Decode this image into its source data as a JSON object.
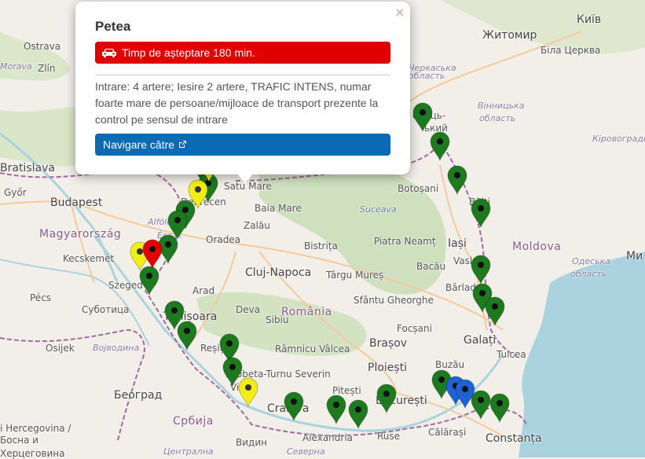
{
  "map": {
    "places": [
      {
        "name": "Ostrava",
        "cls": "place"
      },
      {
        "name": "Morava",
        "cls": "place region"
      },
      {
        "name": "Zlín",
        "cls": "place"
      },
      {
        "name": "Bratislava",
        "cls": "place big"
      },
      {
        "name": "Győr",
        "cls": "place"
      },
      {
        "name": "Budapest",
        "cls": "place big"
      },
      {
        "name": "Magyarország",
        "cls": "place country"
      },
      {
        "name": "Kecskemét",
        "cls": "place"
      },
      {
        "name": "Pécs",
        "cls": "place"
      },
      {
        "name": "Szeged",
        "cls": "place"
      },
      {
        "name": "Суботица",
        "cls": "place"
      },
      {
        "name": "Osijek",
        "cls": "place"
      },
      {
        "name": "Војводина",
        "cls": "place region"
      },
      {
        "name": "Београд",
        "cls": "place big"
      },
      {
        "name": "Србија",
        "cls": "place country"
      },
      {
        "name": "i Hercegovina /",
        "cls": "place"
      },
      {
        "name": "Босна и",
        "cls": "place"
      },
      {
        "name": "Херцеговина",
        "cls": "place"
      },
      {
        "name": "Alföld és",
        "cls": "place region"
      },
      {
        "name": "Észak",
        "cls": "place region"
      },
      {
        "name": "Debrecen",
        "cls": "place"
      },
      {
        "name": "Oradea",
        "cls": "place"
      },
      {
        "name": "Arad",
        "cls": "place"
      },
      {
        "name": "Timișoara",
        "cls": "place big"
      },
      {
        "name": "Reșița",
        "cls": "place"
      },
      {
        "name": "Drobeta-Turnu Severin",
        "cls": "place"
      },
      {
        "name": "Vidin",
        "cls": "place"
      },
      {
        "name": "Видин",
        "cls": "place"
      },
      {
        "name": "Craiova",
        "cls": "place big"
      },
      {
        "name": "Alexandria",
        "cls": "place"
      },
      {
        "name": "Ruse",
        "cls": "place"
      },
      {
        "name": "Pitești",
        "cls": "place"
      },
      {
        "name": "Râmnicu Vâlcea",
        "cls": "place"
      },
      {
        "name": "Deva",
        "cls": "place"
      },
      {
        "name": "România",
        "cls": "place country"
      },
      {
        "name": "Cluj-Napoca",
        "cls": "place big"
      },
      {
        "name": "Zalău",
        "cls": "place"
      },
      {
        "name": "Baia Mare",
        "cls": "place"
      },
      {
        "name": "Satu Mare",
        "cls": "place"
      },
      {
        "name": "Bistrița",
        "cls": "place"
      },
      {
        "name": "Târgu Mureș",
        "cls": "place"
      },
      {
        "name": "Sibiu",
        "cls": "place"
      },
      {
        "name": "Sfântu Gheorghe",
        "cls": "place"
      },
      {
        "name": "Brașov",
        "cls": "place big"
      },
      {
        "name": "Ploiești",
        "cls": "place big"
      },
      {
        "name": "București",
        "cls": "place big"
      },
      {
        "name": "Buzău",
        "cls": "place"
      },
      {
        "name": "Focșani",
        "cls": "place"
      },
      {
        "name": "Bacău",
        "cls": "place"
      },
      {
        "name": "Piatra Neamț",
        "cls": "place"
      },
      {
        "name": "Suceava",
        "cls": "place river"
      },
      {
        "name": "Botoșani",
        "cls": "place"
      },
      {
        "name": "Iași",
        "cls": "place big"
      },
      {
        "name": "Vaslui",
        "cls": "place"
      },
      {
        "name": "Moldova",
        "cls": "place country"
      },
      {
        "name": "Bălți",
        "cls": "place"
      },
      {
        "name": "Bârlad",
        "cls": "place"
      },
      {
        "name": "Galați",
        "cls": "place big"
      },
      {
        "name": "Tulcea",
        "cls": "place"
      },
      {
        "name": "Călărași",
        "cls": "place"
      },
      {
        "name": "Constanța",
        "cls": "place big"
      },
      {
        "name": "Житомир",
        "cls": "place big"
      },
      {
        "name": "Київ",
        "cls": "place big"
      },
      {
        "name": "Біла Церква",
        "cls": "place"
      },
      {
        "name": "Вінницька",
        "cls": "place region"
      },
      {
        "name": "область",
        "cls": "place region"
      },
      {
        "name": "Кіровоградська",
        "cls": "place region"
      },
      {
        "name": "Одеська",
        "cls": "place region"
      },
      {
        "name": "область",
        "cls": "place region"
      },
      {
        "name": "Черкаська",
        "cls": "place region"
      },
      {
        "name": "Ми",
        "cls": "place big"
      },
      {
        "name": "область",
        "cls": "place region"
      },
      {
        "name": "енець-",
        "cls": "place"
      },
      {
        "name": "ький",
        "cls": "place"
      },
      {
        "name": "Централна",
        "cls": "place region"
      },
      {
        "name": "Северна",
        "cls": "place region"
      }
    ],
    "colors": {
      "green": "#1e7a1e",
      "yellow": "#f2ee13",
      "red": "#e00000",
      "blue": "#1e62d6",
      "water": "#aad3df",
      "border": "#a06aa0"
    }
  },
  "popup": {
    "title": "Petea",
    "wait_label": "Timp de așteptare 180 min.",
    "description": "Intrare: 4 artere; Iesire 2 artere, TRAFIC INTENS, numar foarte mare de persoane/mijloace de transport prezente la control pe sensul de intrare",
    "nav_label": "Navigare către",
    "close_label": "×",
    "car_icon": "car-icon",
    "external_icon": "external-link-icon"
  }
}
